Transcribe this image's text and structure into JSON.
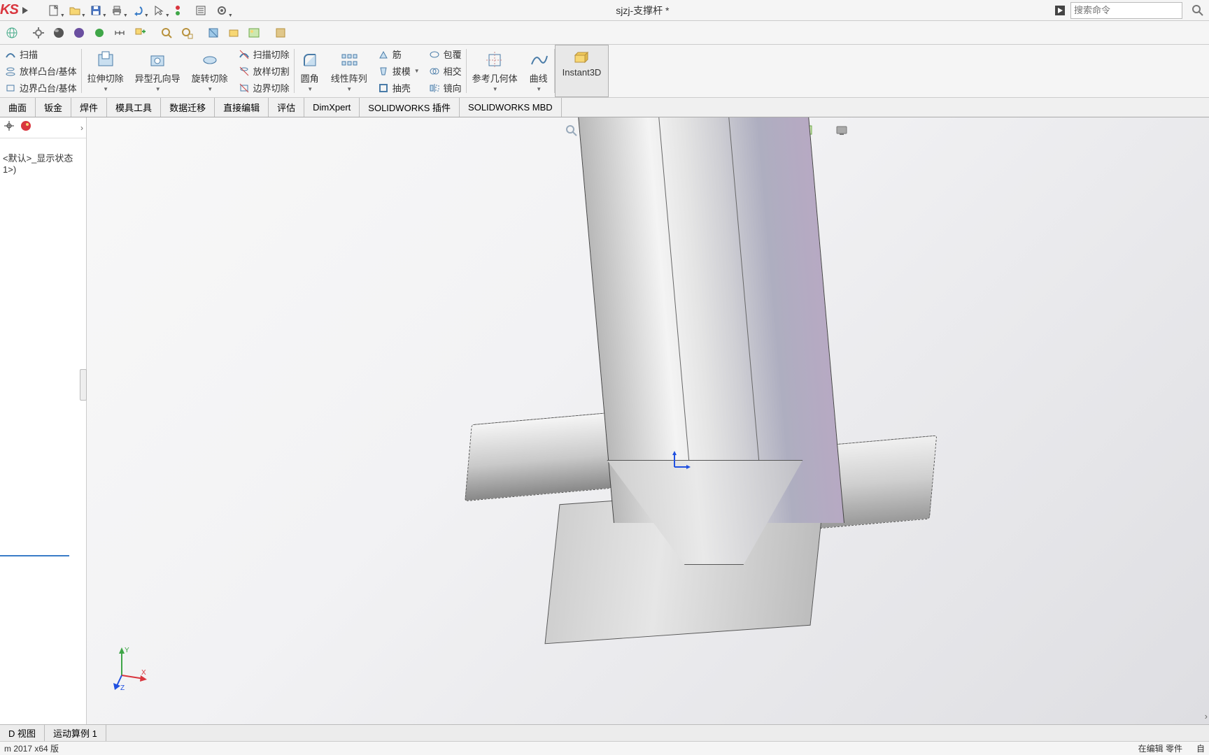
{
  "title": "sjzj-支撑杆 *",
  "search": {
    "placeholder": "搜索命令"
  },
  "ribbon": {
    "col1": {
      "r1": "扫描",
      "r2": "放样凸台/基体",
      "r3": "边界凸台/基体"
    },
    "big1": "拉伸切除",
    "big2": "异型孔向导",
    "big3": "旋转切除",
    "col2": {
      "r1": "扫描切除",
      "r2": "放样切割",
      "r3": "边界切除"
    },
    "big4": "圆角",
    "big5": "线性阵列",
    "col3": {
      "r1": "筋",
      "r2": "拔模",
      "r3": "抽壳"
    },
    "col4": {
      "r1": "包覆",
      "r2": "相交",
      "r3": "镜向"
    },
    "big6": "参考几何体",
    "big7": "曲线",
    "big8": "Instant3D"
  },
  "tabs": [
    "曲面",
    "钣金",
    "焊件",
    "模具工具",
    "数据迁移",
    "直接编辑",
    "评估",
    "DimXpert",
    "SOLIDWORKS 插件",
    "SOLIDWORKS MBD"
  ],
  "tree": {
    "state": "<默认>_显示状态 1>)"
  },
  "bottom_tabs": [
    "D 视图",
    "运动算例 1"
  ],
  "status": {
    "left": "m 2017 x64 版",
    "right1": "在编辑 零件",
    "right2": "自"
  }
}
